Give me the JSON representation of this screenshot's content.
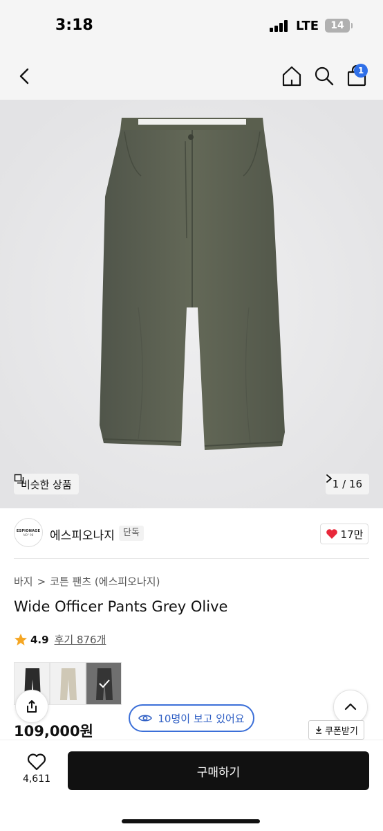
{
  "status_bar": {
    "time": "3:18",
    "network": "LTE",
    "battery": "14"
  },
  "nav": {
    "cart_count": "1"
  },
  "gallery": {
    "similar_label": "비슷한 상품",
    "page_indicator": "1 / 16"
  },
  "brand": {
    "name": "에스피오나지",
    "tag": "단독",
    "likes": "17만",
    "logo_text": "ESPIONAGE",
    "logo_sub": "NO° 98"
  },
  "breadcrumb": {
    "category": "바지",
    "separator": ">",
    "subcategory": "코튼 팬츠 (에스피오나지)"
  },
  "product": {
    "title": "Wide Officer Pants Grey Olive",
    "rating": "4.9",
    "reviews": "후기 876개",
    "price": "109,000원"
  },
  "color_options": [
    {
      "color": "#2b2b2b"
    },
    {
      "color": "#cfc8b6"
    },
    {
      "color": "#353535"
    }
  ],
  "viewers": {
    "label": "10명이 보고 있어요"
  },
  "coupon": {
    "label": "쿠폰받기"
  },
  "bottom_bar": {
    "wish_count": "4,611",
    "buy_label": "구매하기"
  },
  "colors": {
    "accent": "#2f6fe8",
    "heart": "#e8283a",
    "star": "#f5a623",
    "pants": "#5e6352"
  }
}
